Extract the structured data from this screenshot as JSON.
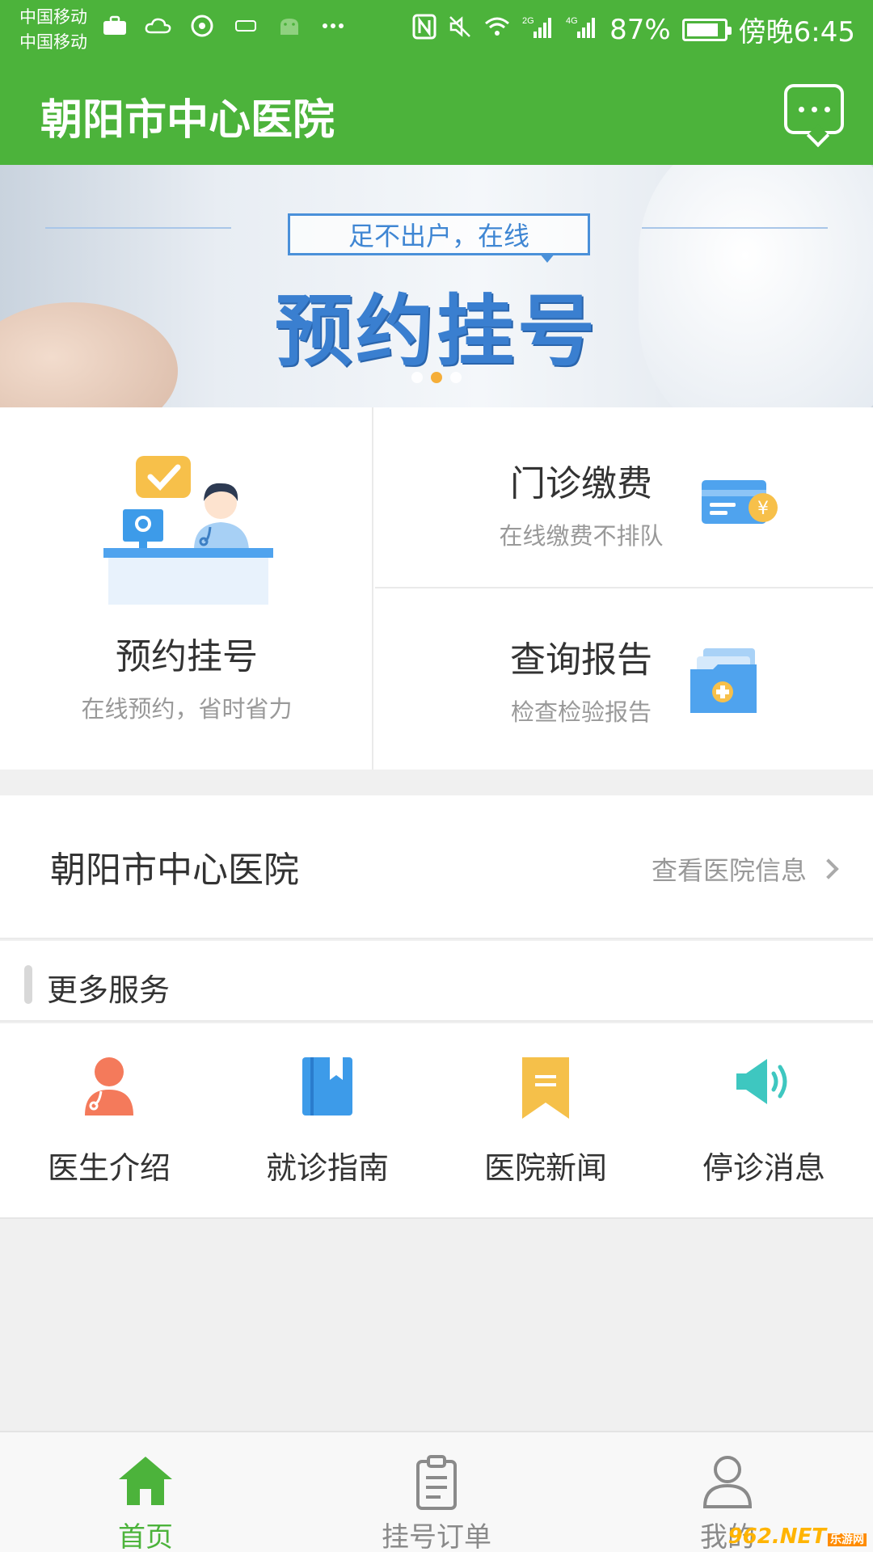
{
  "status_bar": {
    "carrier_1": "中国移动",
    "carrier_2": "中国移动",
    "battery": "87%",
    "battery_level": 0.87,
    "time": "傍晚6:45",
    "signal_1": "2G",
    "signal_2": "4G"
  },
  "header": {
    "title": "朝阳市中心医院",
    "message_icon": "chat-bubble-icon"
  },
  "banner": {
    "tag": "足不出户，在线",
    "headline": "预约挂号",
    "slide_count": 3,
    "active_slide": 2
  },
  "quick_actions": {
    "appointment": {
      "title": "预约挂号",
      "subtitle": "在线预约，省时省力"
    },
    "payment": {
      "title": "门诊缴费",
      "subtitle": "在线缴费不排队"
    },
    "report": {
      "title": "查询报告",
      "subtitle": "检查检验报告"
    }
  },
  "hospital": {
    "name": "朝阳市中心医院",
    "link": "查看医院信息"
  },
  "more_services": {
    "title": "更多服务",
    "items": [
      {
        "label": "医生介绍",
        "icon": "doctor-icon",
        "color": "#f47a5b"
      },
      {
        "label": "就诊指南",
        "icon": "guide-book-icon",
        "color": "#3d9be9"
      },
      {
        "label": "医院新闻",
        "icon": "news-bookmark-icon",
        "color": "#f5c04a"
      },
      {
        "label": "停诊消息",
        "icon": "speaker-icon",
        "color": "#3ec7c0"
      }
    ]
  },
  "tab_bar": {
    "items": [
      {
        "label": "首页",
        "icon": "home-icon",
        "active": true
      },
      {
        "label": "挂号订单",
        "icon": "clipboard-icon",
        "active": false
      },
      {
        "label": "我的",
        "icon": "user-icon",
        "active": false
      }
    ]
  },
  "watermark": {
    "text": "962",
    "suffix": ".NET",
    "cn": "乐游网"
  },
  "colors": {
    "brand_green": "#4cb33b",
    "banner_blue": "#3a7fd0",
    "accent_orange": "#f5a623"
  }
}
